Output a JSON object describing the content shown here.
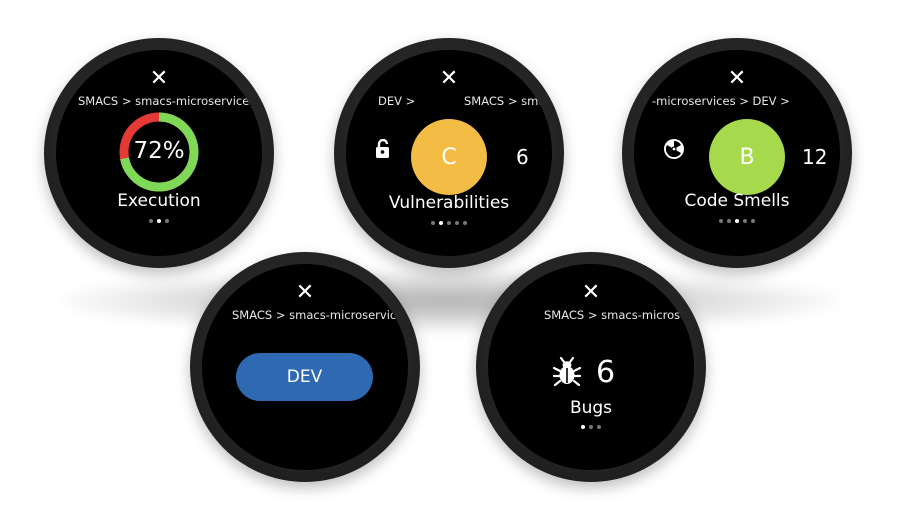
{
  "colors": {
    "pass_green": "#7ed957",
    "fail_red": "#e53935",
    "grade_c": "#f2bc45",
    "grade_b": "#a6d94c",
    "dev_button": "#2f69b3"
  },
  "watches": {
    "execution": {
      "close_glyph": "✕",
      "breadcrumb": "SMACS > smacs-microservices >",
      "percent_label": "72%",
      "percent_value": 72,
      "label": "Execution"
    },
    "vulnerabilities": {
      "close_glyph": "✕",
      "breadcrumb_left": "DEV >",
      "breadcrumb_right": "SMACS > sma",
      "icon": "lock-open-icon",
      "grade": "C",
      "count": "6",
      "label": "Vulnerabilities"
    },
    "code_smells": {
      "close_glyph": "✕",
      "breadcrumb": "-microservices > DEV >",
      "icon": "radioactive-icon",
      "grade": "B",
      "count": "12",
      "label": "Code Smells"
    },
    "branch": {
      "close_glyph": "✕",
      "breadcrumb": "SMACS > smacs-microservic",
      "button_label": "DEV"
    },
    "bugs": {
      "close_glyph": "✕",
      "breadcrumb": "SMACS > smacs-microse",
      "icon": "bug-icon",
      "count": "6",
      "label": "Bugs"
    }
  }
}
